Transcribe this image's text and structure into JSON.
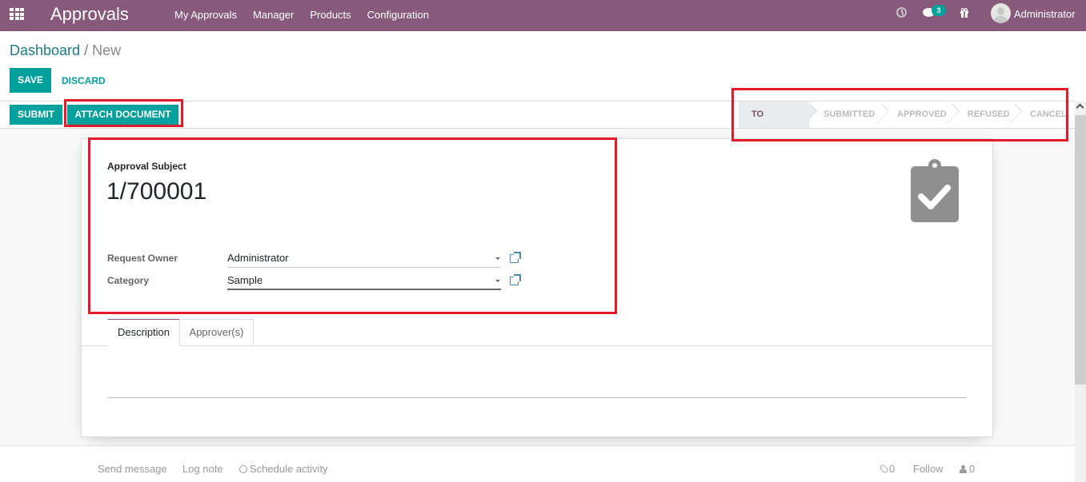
{
  "navbar": {
    "app_title": "Approvals",
    "menu": [
      "My Approvals",
      "Manager",
      "Products",
      "Configuration"
    ],
    "messages_badge": "3",
    "username": "Administrator",
    "bg_color": "#875a7b"
  },
  "breadcrumb": {
    "parent": "Dashboard",
    "separator": "/",
    "current": "New"
  },
  "buttons": {
    "save": "SAVE",
    "discard": "DISCARD",
    "submit": "SUBMIT",
    "attach_document": "ATTACH DOCUMENT"
  },
  "statusbar": {
    "stages": [
      "TO SUBMIT",
      "SUBMITTED",
      "APPROVED",
      "REFUSED",
      "CANCEL"
    ],
    "active_stage": "TO SUBMIT"
  },
  "form": {
    "subject_label": "Approval Subject",
    "subject_value": "1/700001",
    "fields": [
      {
        "label": "Request Owner",
        "value": "Administrator"
      },
      {
        "label": "Category",
        "value": "Sample"
      }
    ]
  },
  "tabs": [
    "Description",
    "Approver(s)"
  ],
  "active_tab": "Description",
  "chatter": {
    "send_message": "Send message",
    "log_note": "Log note",
    "schedule_activity": "Schedule activity",
    "attachments_count": "0",
    "follow": "Follow",
    "followers_count": "0"
  },
  "colors": {
    "primary": "#00a09d",
    "brand": "#875a7b",
    "annotation": "#e21b2a"
  }
}
